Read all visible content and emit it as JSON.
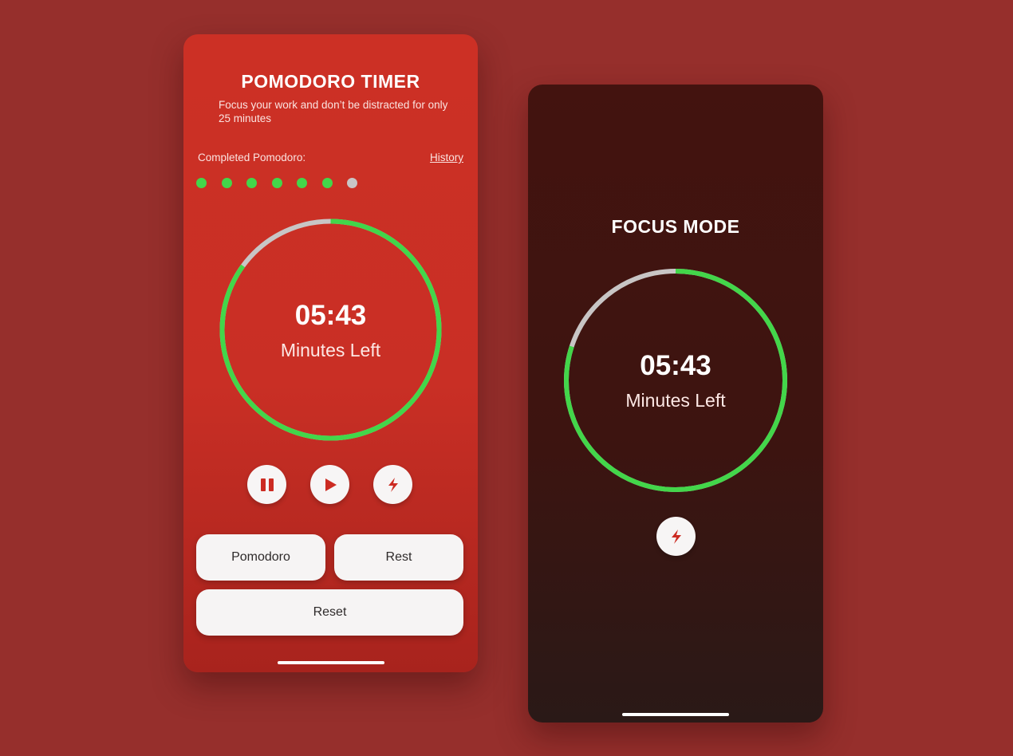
{
  "pomodoro_screen": {
    "title": "POMODORO TIMER",
    "subtitle": "Focus your work and don’t be distracted for only 25 minutes",
    "completed_label": "Completed Pomodoro:",
    "history_link": "History",
    "completed_dots": [
      true,
      true,
      true,
      true,
      true,
      true,
      false
    ],
    "timer": {
      "time": "05:43",
      "label": "Minutes Left",
      "progress": 0.85
    },
    "controls": {
      "pause_icon": "pause-icon",
      "play_icon": "play-icon",
      "focus_icon": "lightning-icon"
    },
    "buttons": {
      "pomodoro": "Pomodoro",
      "rest": "Rest",
      "reset": "Reset"
    }
  },
  "focus_screen": {
    "title": "FOCUS MODE",
    "timer": {
      "time": "05:43",
      "label": "Minutes Left",
      "progress": 0.8
    },
    "controls": {
      "focus_icon": "lightning-icon"
    }
  },
  "colors": {
    "background": "#962f2c",
    "light_card": "#cc3025",
    "dark_card": "#43130f",
    "progress_green": "#43d64a",
    "track_gray": "#c8c5c5",
    "accent_red": "#cc2b22",
    "button_bg": "#f6f4f4"
  }
}
